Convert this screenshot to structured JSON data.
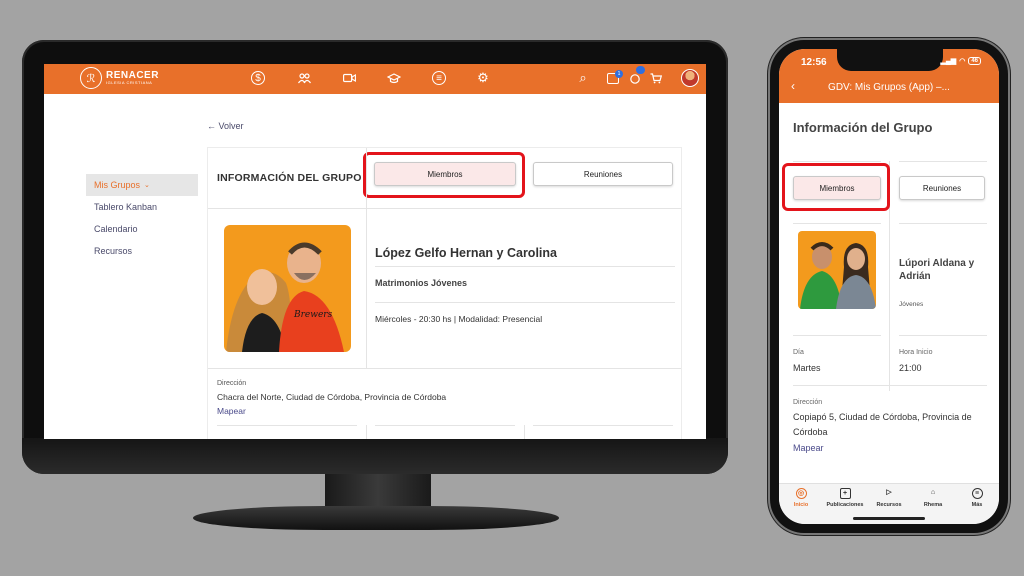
{
  "desktop": {
    "brand": {
      "name": "RENACER",
      "subtitle": "IGLESIA CRISTIANA",
      "logo_glyph": "ℛ"
    },
    "nav_icons": [
      "coin-icon",
      "people-icon",
      "video-icon",
      "graduation-cap-icon",
      "list-icon",
      "gear-icon"
    ],
    "right_icons": {
      "search": "⌕",
      "notif_count": "1",
      "chat_count": "",
      "cart": "🛒"
    },
    "sidebar": {
      "items": [
        {
          "label": "Mis Grupos",
          "active": true
        },
        {
          "label": "Tablero Kanban"
        },
        {
          "label": "Calendario"
        },
        {
          "label": "Recursos"
        }
      ],
      "chevron": "⌄"
    },
    "back_label": "← Volver",
    "card": {
      "title": "INFORMACIÓN DEL GRUPO",
      "tabs": {
        "members": "Miembros",
        "meetings": "Reuniones"
      },
      "leader_name": "López Gelfo Hernan y Carolina",
      "group_type": "Matrimonios Jóvenes",
      "schedule": "Miércoles - 20:30 hs | Modalidad: Presencial",
      "address_label": "Dirección",
      "address": "Chacra del Norte, Ciudad de Córdoba, Provincia de Córdoba",
      "map_link": "Mapear"
    }
  },
  "phone": {
    "status_time": "12:56",
    "battery": "46",
    "header_title": "GDV: Mis Grupos (App) –...",
    "back": "‹",
    "section_title": "Información del Grupo",
    "tabs": {
      "members": "Miembros",
      "meetings": "Reuniones"
    },
    "leader_name": "Lúpori Aldana y Adrián",
    "group_type": "Jóvenes",
    "day_label": "Día",
    "day_value": "Martes",
    "time_label": "Hora Inicio",
    "time_value": "21:00",
    "address_label": "Dirección",
    "address": "Copiapó 5, Ciudad de Córdoba, Provincia de Córdoba",
    "map_link": "Mapear",
    "tabbar": [
      {
        "label": "Inicio",
        "glyph": "◎",
        "active": true
      },
      {
        "label": "Publicaciones",
        "glyph": "+"
      },
      {
        "label": "Recursos",
        "glyph": "▷"
      },
      {
        "label": "Rhema",
        "glyph": "⌂"
      },
      {
        "label": "Más",
        "glyph": "≡"
      }
    ]
  },
  "colors": {
    "brand_orange": "#e8702a",
    "highlight_red": "#e3141b",
    "link": "#4a4a8a"
  }
}
